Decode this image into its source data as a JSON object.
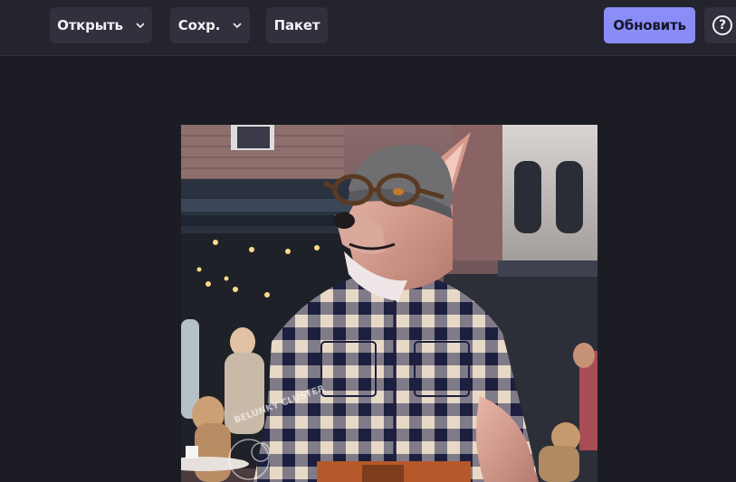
{
  "toolbar": {
    "open_label": "Открыть",
    "save_label": "Сохр.",
    "batch_label": "Пакет",
    "update_label": "Обновить",
    "help_glyph": "?"
  },
  "icons": {
    "open_chevron": "chevron-down-icon",
    "save_chevron": "chevron-down-icon",
    "help": "question-circle-icon"
  },
  "image": {
    "watermark": "BELUNKY CLUSTER",
    "alt": "Wolf in plaid shirt with glasses and beanie on a city street"
  },
  "colors": {
    "accent": "#8b8df7",
    "topbar": "#23242e",
    "button": "#30313c",
    "background": "#1c1c24"
  }
}
